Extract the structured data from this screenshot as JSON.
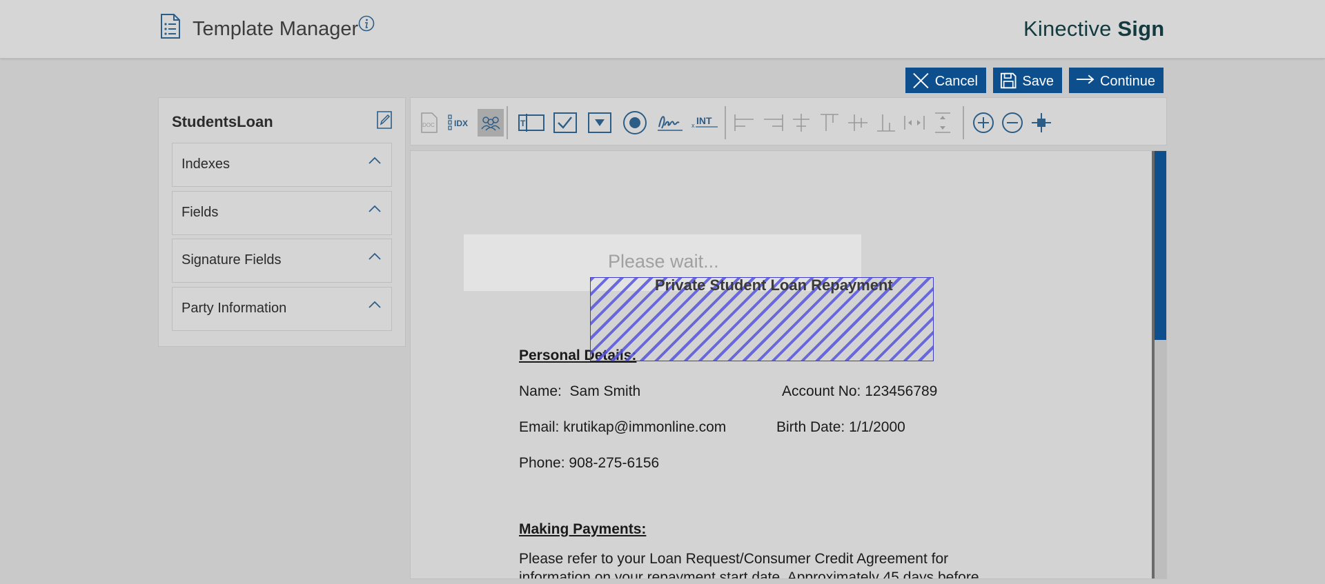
{
  "header": {
    "title": "Template Manager",
    "brand_regular": "Kinective",
    "brand_bold": "Sign",
    "icons": {
      "list": "document-list-icon",
      "info": "info-icon"
    }
  },
  "actions": {
    "cancel_label": "Cancel",
    "save_label": "Save",
    "continue_label": "Continue",
    "color": "#0d4f8c"
  },
  "sidebar": {
    "template_name": "StudentsLoan",
    "sections": [
      {
        "label": "Indexes"
      },
      {
        "label": "Fields"
      },
      {
        "label": "Signature Fields"
      },
      {
        "label": "Party Information"
      }
    ]
  },
  "toolbar": {
    "doc_label": "DOC",
    "idx_label": "IDX",
    "int_label": "INT",
    "int_prefix": "x",
    "tools": [
      "doc-icon",
      "index-icon",
      "parties-icon",
      "text-field-icon",
      "checkbox-icon",
      "dropdown-icon",
      "radio-icon",
      "signature-icon",
      "initials-icon",
      "align-left-icon",
      "align-right-icon",
      "align-center-horizontal-icon",
      "align-top-icon",
      "align-middle-icon",
      "align-bottom-icon",
      "distribute-horizontal-icon",
      "distribute-vertical-icon",
      "zoom-in-icon",
      "zoom-out-icon",
      "fit-icon"
    ]
  },
  "document": {
    "overlay_text": "Please wait...",
    "title": "Private Student Loan Repayment",
    "personal_heading": "Personal Details:",
    "name_label": "Name:",
    "name_value": "Sam Smith",
    "account_label": "Account No:",
    "account_value": "123456789",
    "email_label": "Email:",
    "email_value": "krutikap@immonline.com",
    "birth_label": "Birth Date:",
    "birth_value": "1/1/2000",
    "phone_label": "Phone:",
    "phone_value": "908-275-6156",
    "payments_heading": "Making Payments:",
    "payments_text_1": "Please refer to your Loan Request/Consumer Credit Agreement for",
    "payments_text_2": "information on your repayment start date. Approximately 45 days before"
  }
}
